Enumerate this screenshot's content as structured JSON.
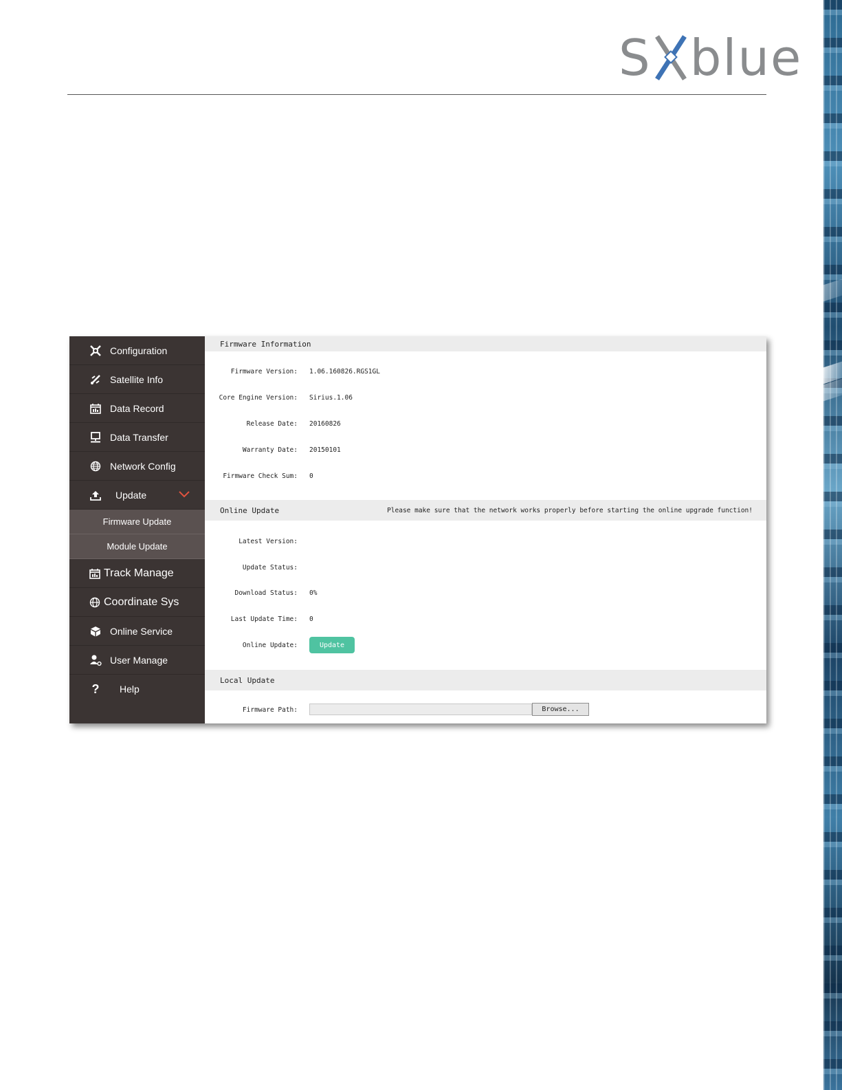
{
  "brand": {
    "logo_left": "S",
    "logo_right": "blue"
  },
  "sidebar": {
    "items": [
      {
        "label": "Configuration",
        "icon": "tools-icon"
      },
      {
        "label": "Satellite Info",
        "icon": "satellite-icon"
      },
      {
        "label": "Data Record",
        "icon": "calendar-icon"
      },
      {
        "label": "Data Transfer",
        "icon": "monitor-icon"
      },
      {
        "label": "Network Config",
        "icon": "globe-icon"
      },
      {
        "label": "Update",
        "icon": "upload-icon"
      }
    ],
    "sub_items": [
      {
        "label": "Firmware Update"
      },
      {
        "label": "Module Update"
      }
    ],
    "items_after": [
      {
        "label": "Track Manage",
        "icon": "calendar-icon"
      },
      {
        "label": "Coordinate Sys",
        "icon": "globe-icon"
      },
      {
        "label": "Online Service",
        "icon": "cube-icon"
      },
      {
        "label": "User Manage",
        "icon": "user-icon"
      },
      {
        "label": "Help",
        "icon": "question-icon"
      }
    ]
  },
  "firmware_info": {
    "title": "Firmware Information",
    "rows": [
      {
        "label": "Firmware Version:",
        "value": "1.06.160826.RGS1GL"
      },
      {
        "label": "Core Engine Version:",
        "value": "Sirius.1.06"
      },
      {
        "label": "Release Date:",
        "value": "20160826"
      },
      {
        "label": "Warranty Date:",
        "value": "20150101"
      },
      {
        "label": "Firmware Check Sum:",
        "value": "0"
      }
    ]
  },
  "online_update": {
    "title": "Online Update",
    "note": "Please make sure that the network works properly before starting the online upgrade function!",
    "rows": [
      {
        "label": "Latest Version:",
        "value": ""
      },
      {
        "label": "Update Status:",
        "value": ""
      },
      {
        "label": "Download Status:",
        "value": "0%"
      },
      {
        "label": "Last Update Time:",
        "value": "0"
      },
      {
        "label": "Online Update:",
        "value": ""
      }
    ],
    "button_label": "Update"
  },
  "local_update": {
    "title": "Local Update",
    "path_label": "Firmware Path:",
    "browse_label": "Browse..."
  },
  "colors": {
    "sidebar_bg": "#3b3433",
    "submenu_bg": "#5a5150",
    "accent_green": "#4fc3a1",
    "chevron": "#e0533f"
  }
}
